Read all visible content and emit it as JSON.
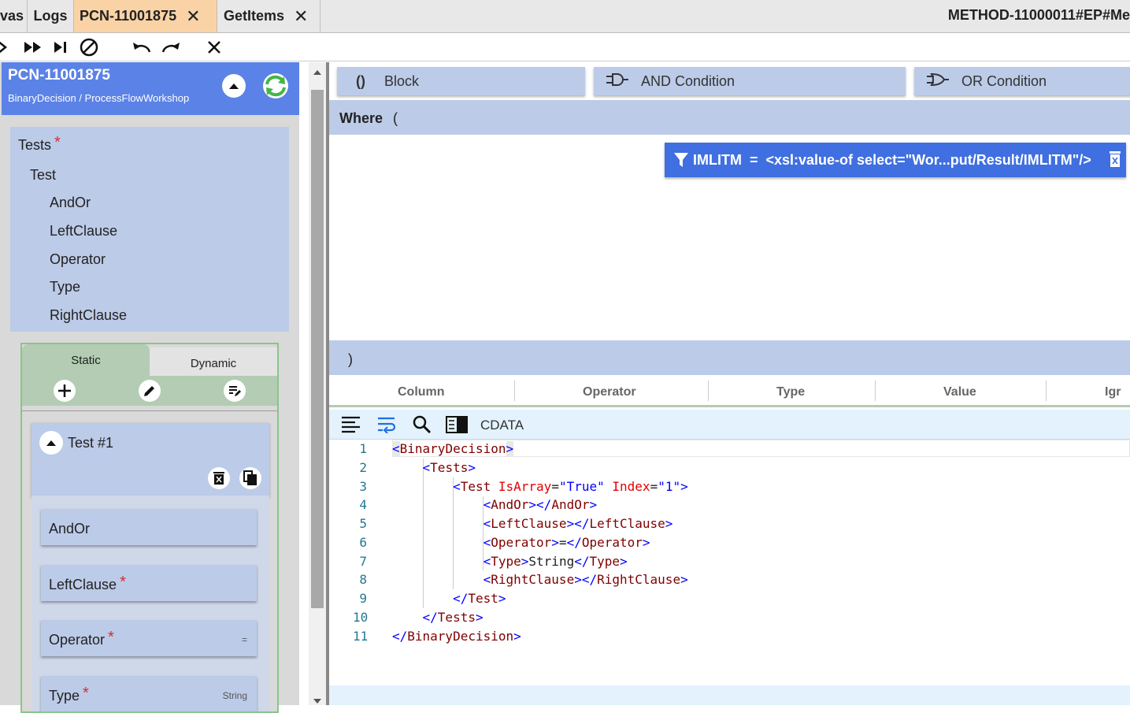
{
  "tabs": [
    {
      "label": "vas",
      "closable": false,
      "active": false
    },
    {
      "label": "Logs",
      "closable": false,
      "active": false
    },
    {
      "label": "PCN-11001875",
      "closable": true,
      "active": true
    },
    {
      "label": "GetItems",
      "closable": true,
      "active": false
    }
  ],
  "tab_close_glyph": "✕",
  "method_title": "METHOD-11000011#EP#Me",
  "toolbar": {
    "icons": [
      "play-icon",
      "fast-forward-icon",
      "step-icon",
      "stop-icon",
      "undo-icon",
      "redo-icon",
      "close-icon"
    ]
  },
  "left_header": {
    "title": "PCN-11001875",
    "subtitle": "BinaryDecision / ProcessFlowWorkshop"
  },
  "tree": {
    "root": "Tests",
    "root_required": "*",
    "child": "Test",
    "items": [
      "AndOr",
      "LeftClause",
      "Operator",
      "Type",
      "RightClause"
    ]
  },
  "panel": {
    "tabs": [
      "Static",
      "Dynamic"
    ],
    "active_tab": "Static",
    "tool_icons": [
      "add-icon",
      "edit-icon",
      "edit-notes-icon"
    ],
    "card_title": "Test #1",
    "fields": [
      {
        "label": "AndOr",
        "required": "",
        "value": ""
      },
      {
        "label": "LeftClause",
        "required": "*",
        "value": ""
      },
      {
        "label": "Operator",
        "required": "*",
        "value": "="
      },
      {
        "label": "Type",
        "required": "*",
        "value": "String"
      }
    ]
  },
  "conditions": {
    "block": {
      "icon": "()",
      "label": "Block"
    },
    "and": {
      "label": "AND Condition"
    },
    "or": {
      "label": "OR Condition"
    }
  },
  "where": {
    "label": "Where",
    "open_paren": "(",
    "close_paren": ")"
  },
  "filter": {
    "field": "IMLITM",
    "operator": "=",
    "value": "<xsl:value-of select=\"Wor...put/Result/IMLITM\"/>"
  },
  "columns": [
    "Column",
    "Operator",
    "Type",
    "Value",
    "Igr"
  ],
  "editor": {
    "cdata_label": "CDATA",
    "line_numbers": [
      "1",
      "2",
      "3",
      "4",
      "5",
      "6",
      "7",
      "8",
      "9",
      "10",
      "11"
    ]
  },
  "colors": {
    "active_tab": "#f9d3a6",
    "header_blue": "#5b82e6",
    "panel_blue": "#bccbe8",
    "filter_blue": "#3f6fe0",
    "green": "#8bc48b",
    "refresh_green": "#43b649"
  }
}
